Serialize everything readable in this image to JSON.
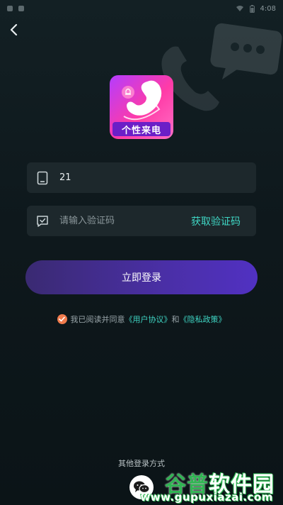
{
  "status_bar": {
    "time": "4:08"
  },
  "app": {
    "logo_label": "个性来电"
  },
  "phone_field": {
    "value": "21",
    "icon": "phone-icon"
  },
  "code_field": {
    "placeholder": "请输入验证码",
    "icon": "message-check-icon",
    "get_code_label": "获取验证码"
  },
  "login_button_label": "立即登录",
  "agreement": {
    "prefix": "我已阅读并同意",
    "user_agreement": "《用户协议》",
    "and": "和",
    "privacy_policy": "《隐私政策》",
    "checked": true
  },
  "other_login": {
    "label": "其他登录方式",
    "wechat_icon": "wechat-icon"
  },
  "watermark": {
    "brand_part1": "谷普",
    "brand_part2": "软件园",
    "url": "www.gupuxiazai.com"
  },
  "colors": {
    "accent": "#3fd6c4",
    "button": "#4a2fa6",
    "check": "#f07b4d",
    "background": "#0f1a1e"
  }
}
